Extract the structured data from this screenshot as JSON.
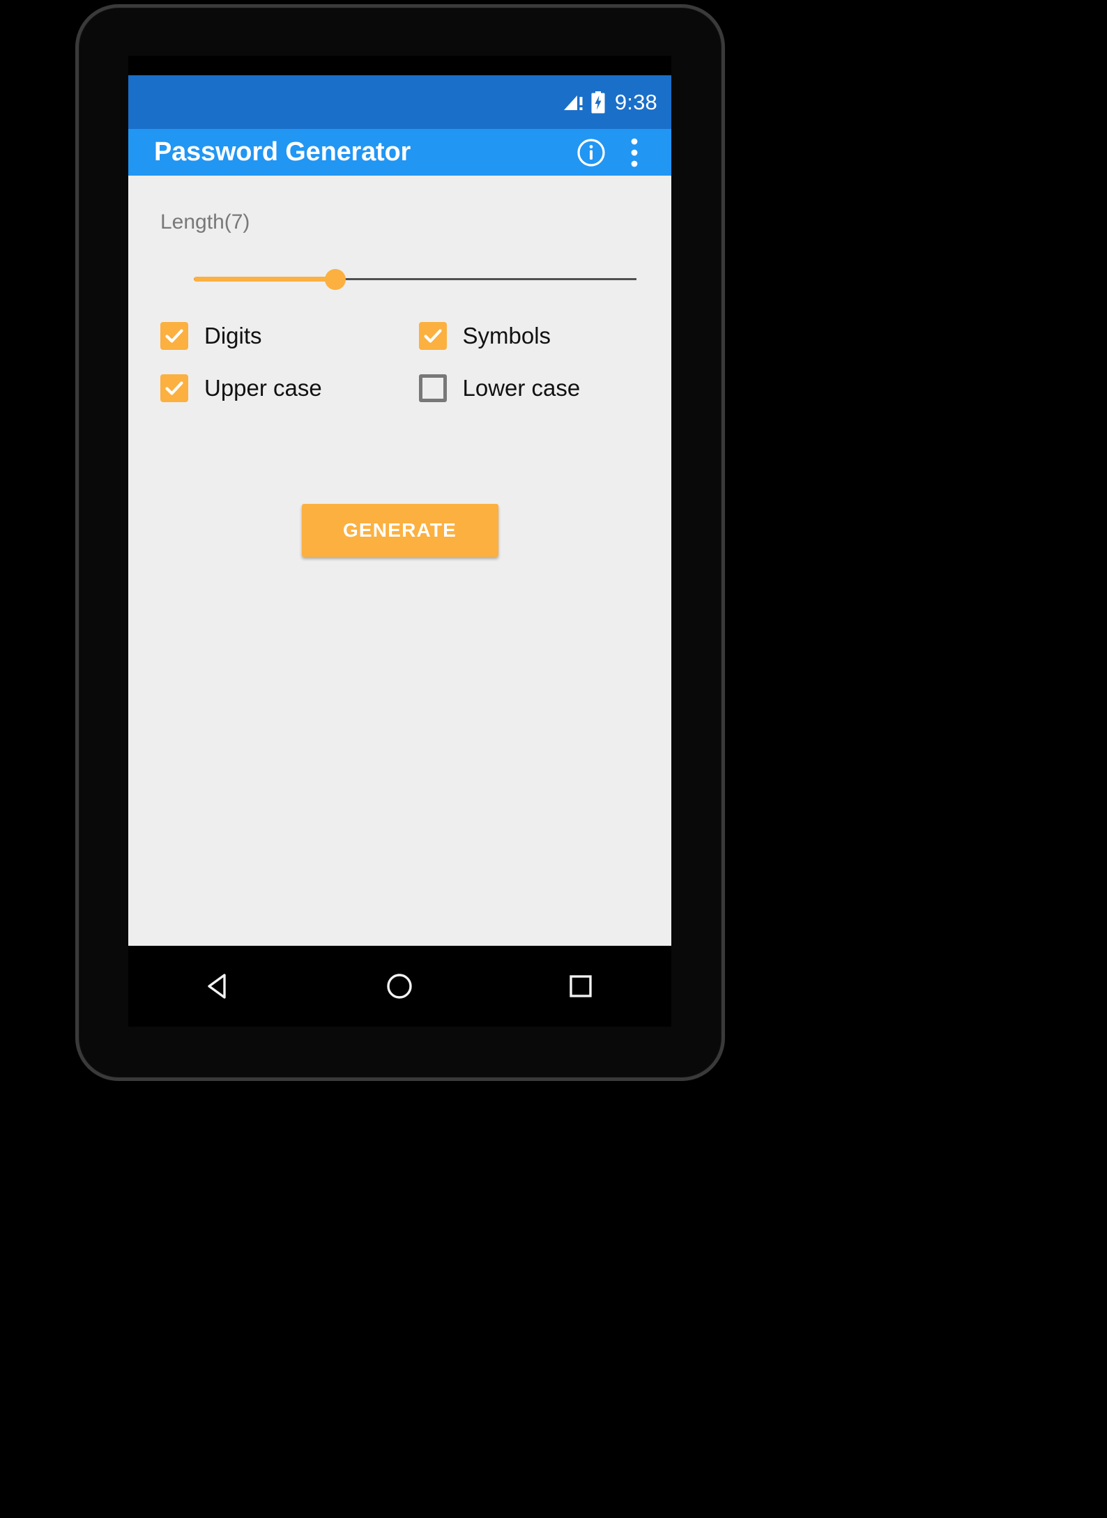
{
  "device": {
    "frame_color": "#0d0d0d",
    "background": "#000000"
  },
  "status_bar": {
    "background": "#1a6fc9",
    "time": "9:38",
    "icons": [
      "signal-cellular-alert-icon",
      "battery-charging-icon"
    ]
  },
  "app_bar": {
    "background": "#2196f3",
    "title": "Password Generator",
    "actions": [
      {
        "name": "info-icon",
        "label": "Info"
      },
      {
        "name": "overflow-menu-icon",
        "label": "More options"
      }
    ]
  },
  "content": {
    "background": "#eeeeee",
    "accent": "#fbb040",
    "length": {
      "label": "Length(7)",
      "value": 7,
      "min": 1,
      "max": 20,
      "percent": 32
    },
    "options": [
      {
        "label": "Digits",
        "checked": true
      },
      {
        "label": "Symbols",
        "checked": true
      },
      {
        "label": "Upper case",
        "checked": true
      },
      {
        "label": "Lower case",
        "checked": false
      }
    ],
    "generate_button": "GENERATE"
  },
  "nav_bar": {
    "background": "#000000",
    "buttons": [
      {
        "name": "back-icon",
        "label": "Back"
      },
      {
        "name": "home-icon",
        "label": "Home"
      },
      {
        "name": "recents-icon",
        "label": "Recents"
      }
    ]
  }
}
